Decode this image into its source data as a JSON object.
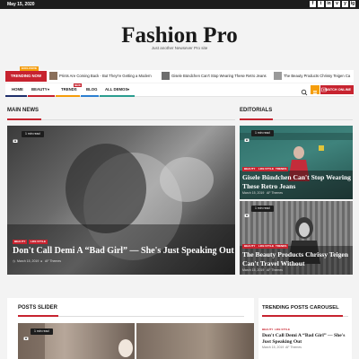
{
  "topbar": {
    "date": "May 15, 2020",
    "social": [
      "f",
      "t",
      "in",
      "v",
      "y",
      "ig"
    ]
  },
  "header": {
    "site_title": "Fashion Pro",
    "tagline": "Just another Newsever Pro site"
  },
  "ticker": {
    "label": "TRENDING NOW",
    "badge": "EXCLUSIVE",
    "items": [
      "Prints Are Coming Back - But They're Getting a Modern",
      "Gisele Bündchen Can't Stop Wearing These Retro Jeans",
      "The Beauty Products Chrissy Teigen Ca"
    ]
  },
  "nav": {
    "items": [
      "HOME",
      "BEAUTY",
      "TRENDS",
      "BLOG",
      "ALL DEMOS"
    ],
    "new_badge": "NEW",
    "watch_label": "WATCH ONLINE",
    "colors": {
      "home": "#1f2f6b",
      "beauty": "#c7232f",
      "trends": "#f59d0b",
      "blog": "#2b7fd1",
      "demos": "#2a9d8f"
    }
  },
  "main_news": {
    "heading": "MAIN NEWS",
    "read_time": "1 min read",
    "categories": [
      "BEAUTY",
      "LIFE STYLE"
    ],
    "title": "Don't Call Demi A “Bad Girl” — She's Just Speaking Out",
    "date": "March 15, 2019",
    "author": "AF Themes"
  },
  "editorials": {
    "heading": "EDITORIALS",
    "posts": [
      {
        "read_time": "1 min read",
        "categories": [
          "BEAUTY",
          "LIFE STYLE",
          "TRENDS"
        ],
        "title": "Gisele Bündchen Can't Stop Wearing These Retro Jeans",
        "date": "March 15, 2019",
        "author": "AF Themes"
      },
      {
        "read_time": "1 min read",
        "categories": [
          "BEAUTY",
          "LIFE STYLE",
          "TRENDS"
        ],
        "title": "The Beauty Products Chrissy Teigen Can't Travel Without",
        "date": "March 15, 2019",
        "author": "AF Themes"
      }
    ]
  },
  "posts_slider": {
    "heading": "POSTS SLIDER",
    "read_time": "1 min read"
  },
  "trending_carousel": {
    "heading": "TRENDING POSTS CAROUSEL",
    "categories": [
      "BEAUTY",
      "LIFE STYLE"
    ],
    "title": "Don't Call Demi A “Bad Girl” — She's Just Speaking Out",
    "date": "March 15, 2019",
    "author": "AF Themes"
  },
  "colors": {
    "accent": "#c7232f",
    "orange": "#f59d0b",
    "dark": "#1d1d1d"
  }
}
